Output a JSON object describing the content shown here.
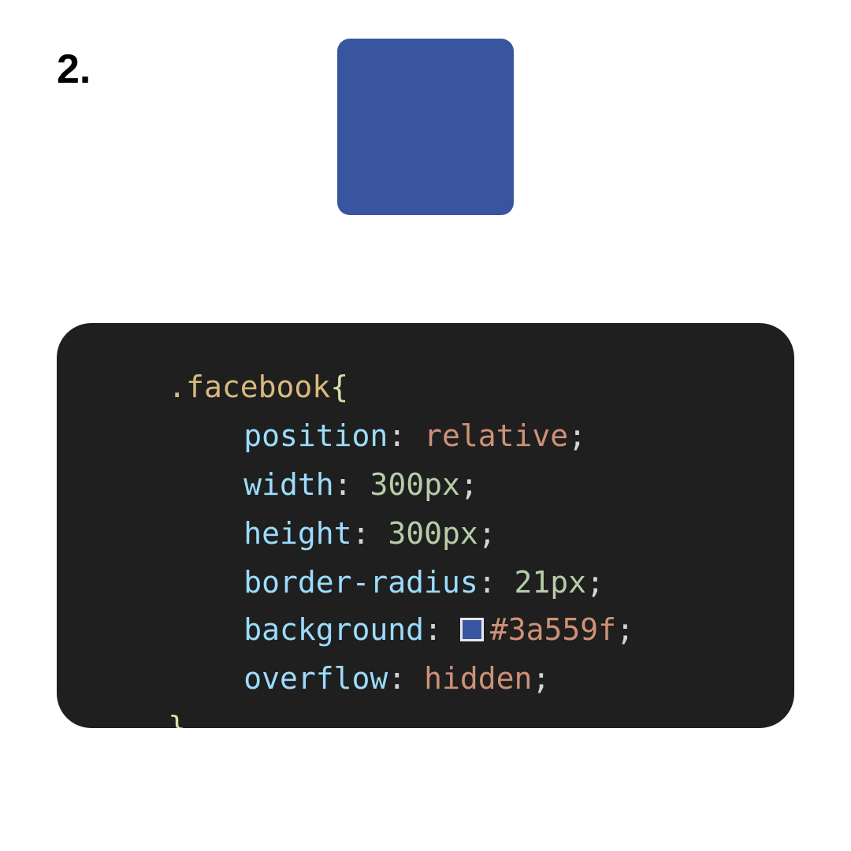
{
  "step": {
    "label": "2."
  },
  "preview": {
    "color": "#3a559f"
  },
  "code": {
    "selector": ".facebook",
    "open_brace": "{",
    "close_brace": "}",
    "declarations": [
      {
        "property": "position",
        "value": "relative",
        "value_type": "str"
      },
      {
        "property": "width",
        "value": "300px",
        "value_type": "num"
      },
      {
        "property": "height",
        "value": "300px",
        "value_type": "num"
      },
      {
        "property": "border-radius",
        "value": "21px",
        "value_type": "num"
      },
      {
        "property": "background",
        "value": "#3a559f",
        "value_type": "color"
      },
      {
        "property": "overflow",
        "value": "hidden",
        "value_type": "str"
      }
    ],
    "swatch_color": "#3a559f"
  },
  "colors": {
    "panel_background": "#1f1f1f",
    "selector": "#d7ba7d",
    "property": "#9cdcfe",
    "string_value": "#ce9178",
    "number_value": "#b5cea8"
  }
}
